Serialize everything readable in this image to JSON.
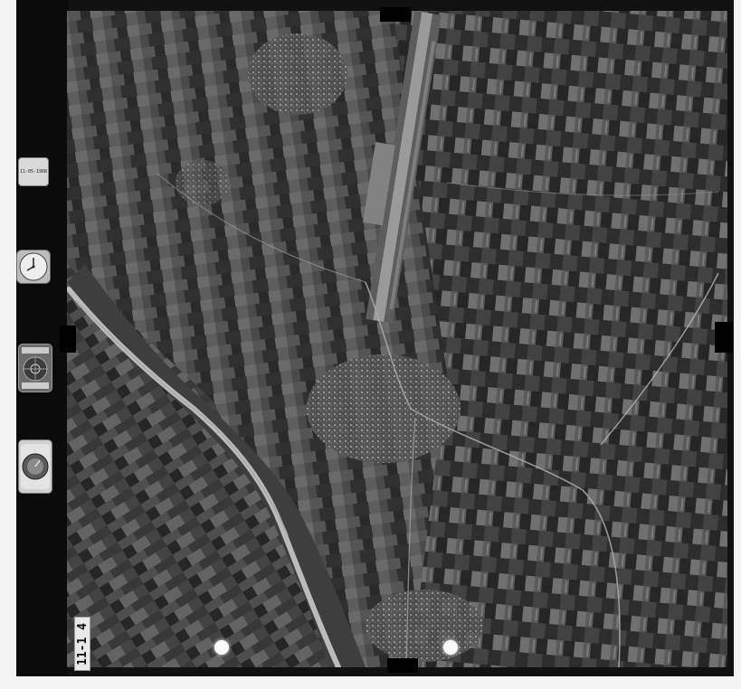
{
  "photo": {
    "data_panel_text": "11-05-1988",
    "frame_label": "11-1 4"
  },
  "colors": {
    "film_border": "#111111",
    "paper_margin": "#f4f4f4",
    "runway": "#9a9a9a",
    "river": "#c9c9c9",
    "town": "#8a8a8a"
  }
}
